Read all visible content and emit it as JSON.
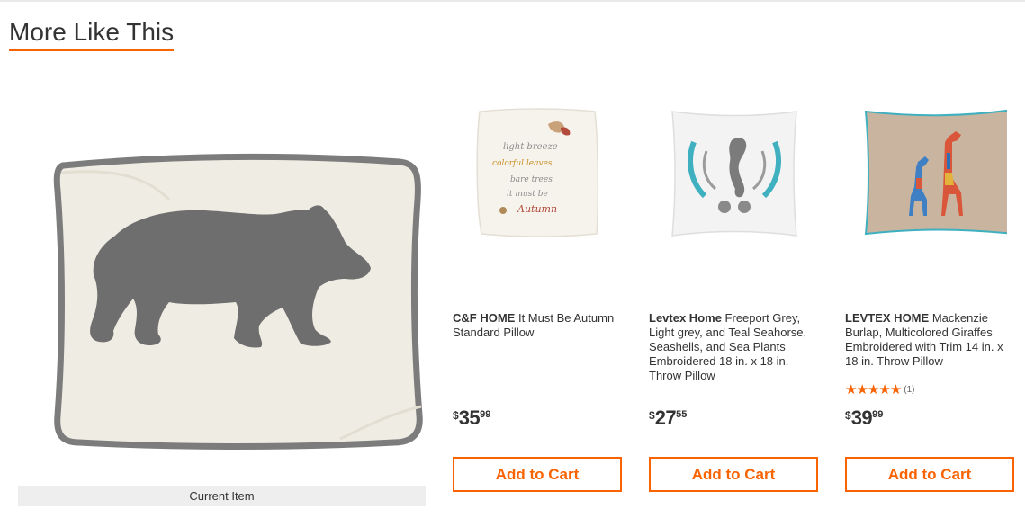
{
  "section": {
    "title": "More Like This"
  },
  "current_item": {
    "label": "Current Item"
  },
  "products": [
    {
      "brand": "C&F HOME",
      "name": "It Must Be Autumn Standard Pillow",
      "price": {
        "currency": "$",
        "dollars": "35",
        "cents": "99"
      },
      "button_label": "Add to Cart",
      "pillow_text": [
        "light breeze",
        "colorful leaves",
        "bare trees",
        "it must be",
        "Autumn"
      ]
    },
    {
      "brand": "Levtex Home",
      "name": "Freeport Grey, Light grey, and Teal Seahorse, Seashells, and Sea Plants Embroidered 18 in. x 18 in. Throw Pillow",
      "price": {
        "currency": "$",
        "dollars": "27",
        "cents": "55"
      },
      "button_label": "Add to Cart"
    },
    {
      "brand": "LEVTEX HOME",
      "name": "Mackenzie Burlap, Multicolored Giraffes Embroidered with Trim 14 in. x 18 in. Throw Pillow",
      "rating": {
        "stars": "★★★★★",
        "count": "(1)",
        "value": 5
      },
      "price": {
        "currency": "$",
        "dollars": "39",
        "cents": "99"
      },
      "button_label": "Add to Cart"
    }
  ],
  "colors": {
    "accent": "#f96302",
    "text": "#333333",
    "label_bg": "#eeeeee"
  }
}
